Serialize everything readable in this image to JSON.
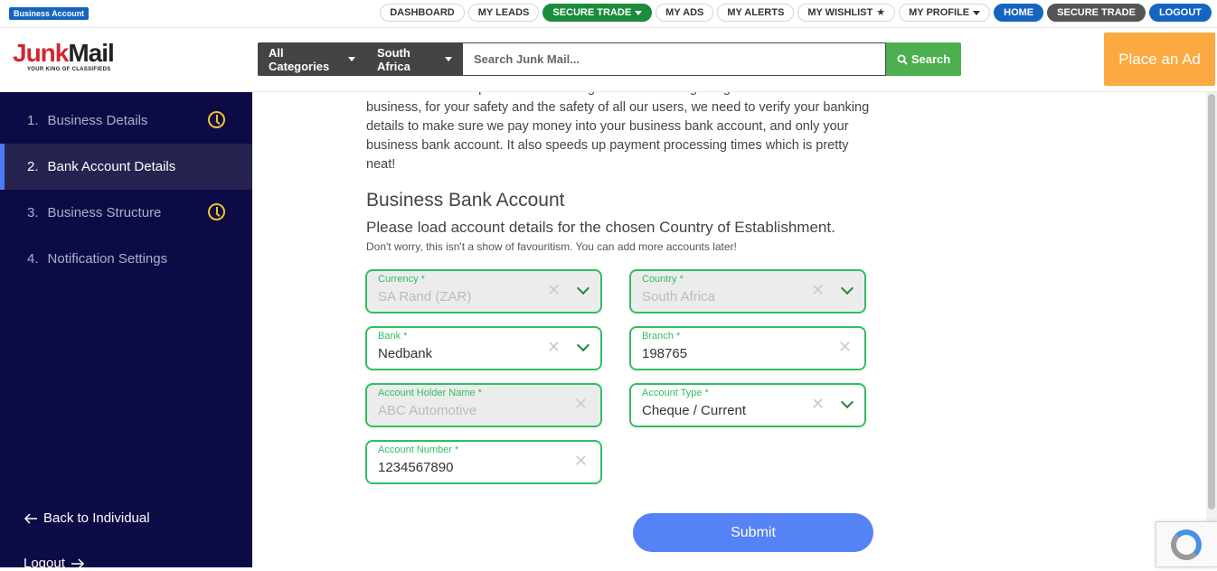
{
  "topbar": {
    "badge": "Business Account",
    "nav": [
      {
        "label": "DASHBOARD",
        "style": "plain"
      },
      {
        "label": "MY LEADS",
        "style": "plain"
      },
      {
        "label": "SECURE TRADE",
        "style": "green",
        "caret": true
      },
      {
        "label": "MY ADS",
        "style": "plain"
      },
      {
        "label": "MY ALERTS",
        "style": "plain"
      },
      {
        "label": "MY WISHLIST",
        "style": "plain",
        "star": true
      },
      {
        "label": "MY PROFILE",
        "style": "plain",
        "caret": true
      },
      {
        "label": "HOME",
        "style": "blue"
      },
      {
        "label": "SECURE TRADE",
        "style": "grey"
      },
      {
        "label": "LOGOUT",
        "style": "blue"
      }
    ]
  },
  "header": {
    "logo_part1": "Junk",
    "logo_part2": "Mail",
    "logo_tagline": "YOUR KING OF CLASSIFIEDS",
    "category_dropdown": "All Categories",
    "region_dropdown": "South Africa",
    "search_placeholder": "Search Junk Mail...",
    "search_button": "Search",
    "place_ad": "Place an Ad"
  },
  "sidebar": {
    "items": [
      {
        "num": "1.",
        "label": "Business Details",
        "active": false,
        "pending": true
      },
      {
        "num": "2.",
        "label": "Bank Account Details",
        "active": true,
        "pending": false
      },
      {
        "num": "3.",
        "label": "Business Structure",
        "active": false,
        "pending": true
      },
      {
        "num": "4.",
        "label": "Notification Settings",
        "active": false,
        "pending": false
      }
    ],
    "back_link": "Back to Individual",
    "logout_link": "Logout"
  },
  "main": {
    "intro": "our commitment to protect our users against fraud. Being a regulated financial business, for your safety and the safety of all our users, we need to verify your banking details to make sure we pay money into your business bank account, and only your business bank account. It also speeds up payment processing times which is pretty neat!",
    "title": "Business Bank Account",
    "subtitle": "Please load account details for the chosen Country of Establishment.",
    "note": "Don't worry, this isn't a show of favouritism. You can add more accounts later!",
    "fields": {
      "currency": {
        "label": "Currency *",
        "value": "SA Rand (ZAR)"
      },
      "country": {
        "label": "Country *",
        "value": "South Africa"
      },
      "bank": {
        "label": "Bank *",
        "value": "Nedbank"
      },
      "branch": {
        "label": "Branch *",
        "value": "198765"
      },
      "holder": {
        "label": "Account Holder Name *",
        "value": "ABC Automotive"
      },
      "type": {
        "label": "Account Type *",
        "value": "Cheque / Current"
      },
      "number": {
        "label": "Account Number *",
        "value": "1234567890"
      }
    },
    "submit": "Submit"
  },
  "colors": {
    "sidebar_bg": "#0d0b45",
    "field_border": "#2fbf5f",
    "submit": "#5582f5",
    "place_ad": "#fbaa41",
    "search_button": "#4caf50"
  }
}
